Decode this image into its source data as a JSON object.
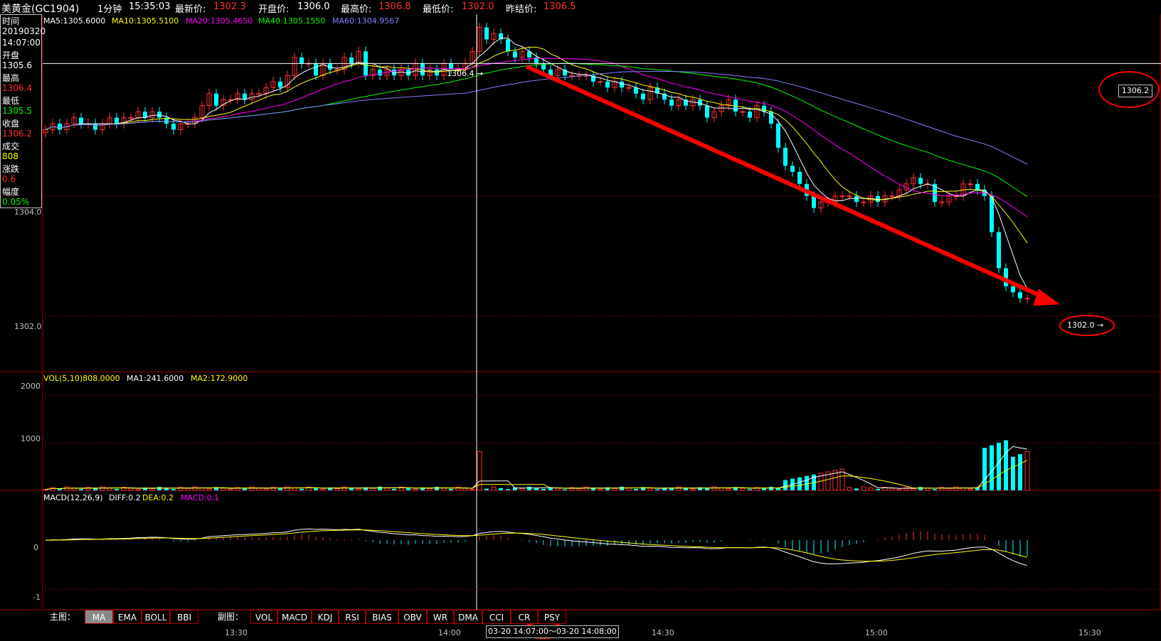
{
  "header": {
    "name": "美黄金(GC1904)",
    "period": "1分钟",
    "time": "15:35:03",
    "latest_label": "最新价:",
    "latest_value": "1302.3",
    "open_label": "开盘价:",
    "open_value": "1306.0",
    "high_label": "最高价:",
    "high_value": "1306.8",
    "low_label": "最低价:",
    "low_value": "1302.0",
    "prev_label": "昨结价:",
    "prev_value": "1306.5"
  },
  "info_panel": {
    "time_label": "时间",
    "date": "20190320",
    "time": "14:07:00",
    "open_label": "开盘",
    "open_value": "1305.6",
    "high_label": "最高",
    "high_value": "1306.4",
    "low_label": "最低",
    "low_value": "1305.5",
    "close_label": "收盘",
    "close_value": "1306.2",
    "volume_label": "成交",
    "volume_value": "808",
    "change_label": "涨跌",
    "change_value": "0.6",
    "range_label": "幅度",
    "range_value": "0.05%"
  },
  "ma_legend": {
    "ma5": "MA5:1305.6000",
    "ma10": "MA10:1305.5100",
    "ma20": "MA20:1305.4650",
    "ma40": "MA40:1305.1550",
    "ma60": "MA60:1304.9567"
  },
  "vol_legend": {
    "vol": "VOL(5,10)808.0000",
    "ma1": "MA1:241.6000",
    "ma2": "MA2:172.9000"
  },
  "macd_legend": {
    "name": "MACD(12,26,9)",
    "diff": "DIFF:0.2",
    "dea": "DEA:0.2",
    "macd": "MACD:0.1"
  },
  "price_axis": {
    "label_1304": "1304.0",
    "label_1302": "1302.0",
    "hover_price": "1306.2",
    "peak_marker": "1306.4",
    "low_marker": "1302.0"
  },
  "vol_axis": {
    "label_2000": "2000",
    "label_1000": "1000"
  },
  "macd_axis": {
    "label_0": "0",
    "label_neg1": "-1"
  },
  "toolbar": {
    "main_label": "主图：",
    "main_buttons": [
      "MA",
      "EMA",
      "BOLL",
      "BBI"
    ],
    "sub_label": "副图：",
    "sub_buttons": [
      "VOL",
      "MACD",
      "KDJ",
      "RSI",
      "BIAS",
      "OBV",
      "WR",
      "DMA",
      "CCI",
      "CR",
      "PSY"
    ]
  },
  "time_axis": {
    "labels": [
      "13:30",
      "14:00",
      "14:30",
      "15:00",
      "15:30"
    ],
    "range_label": "03-20 14:07:00～03-20 14:08:00"
  },
  "colors": {
    "up": "#ff3030",
    "down": "#00ffff",
    "ma5": "#ffffff",
    "ma10": "#ffff00",
    "ma20": "#ff00ff",
    "ma40": "#00ff00",
    "ma60": "#8080ff",
    "grid": "#a00000",
    "annotation": "#ff0000"
  },
  "chart_data": {
    "type": "candlestick",
    "interval": "1 minute",
    "price_range": [
      1301.2,
      1306.9
    ],
    "closes": [
      1305.1,
      1305.2,
      1305.1,
      1305.2,
      1305.3,
      1305.2,
      1305.2,
      1305.1,
      1305.2,
      1305.3,
      1305.2,
      1305.3,
      1305.3,
      1305.4,
      1305.3,
      1305.4,
      1305.3,
      1305.2,
      1305.1,
      1305.2,
      1305.2,
      1305.3,
      1305.5,
      1305.7,
      1305.5,
      1305.6,
      1305.6,
      1305.7,
      1305.6,
      1305.7,
      1305.7,
      1305.8,
      1305.9,
      1305.8,
      1306.0,
      1306.3,
      1306.2,
      1306.2,
      1306.0,
      1306.2,
      1306.1,
      1306.1,
      1306.3,
      1306.2,
      1306.4,
      1306.0,
      1306.1,
      1306.0,
      1306.1,
      1306.0,
      1306.1,
      1306.0,
      1306.2,
      1306.0,
      1306.1,
      1306.0,
      1306.2,
      1306.1,
      1306.1,
      1306.2,
      1306.4,
      1306.8,
      1306.6,
      1306.7,
      1306.6,
      1306.4,
      1306.3,
      1306.4,
      1306.3,
      1306.2,
      1306.1,
      1306.0,
      1306.1,
      1306.0,
      1306.0,
      1306.0,
      1306.0,
      1305.9,
      1305.9,
      1305.8,
      1305.9,
      1305.8,
      1305.8,
      1305.7,
      1305.6,
      1305.8,
      1305.7,
      1305.6,
      1305.5,
      1305.6,
      1305.5,
      1305.6,
      1305.5,
      1305.3,
      1305.4,
      1305.5,
      1305.6,
      1305.4,
      1305.4,
      1305.3,
      1305.5,
      1305.4,
      1305.2,
      1304.8,
      1304.5,
      1304.4,
      1304.2,
      1304.0,
      1303.8,
      1303.9,
      1303.9,
      1304.0,
      1304.0,
      1304.0,
      1303.9,
      1303.9,
      1304.0,
      1303.9,
      1304.0,
      1304.0,
      1304.1,
      1304.2,
      1304.3,
      1304.2,
      1304.2,
      1303.9,
      1303.9,
      1304.0,
      1304.0,
      1304.2,
      1304.2,
      1304.1,
      1304.0,
      1303.4,
      1302.8,
      1302.5,
      1302.4,
      1302.3,
      1302.3
    ],
    "volume_range": [
      0,
      2500
    ],
    "macd_range": [
      -1.3,
      0.9
    ]
  }
}
